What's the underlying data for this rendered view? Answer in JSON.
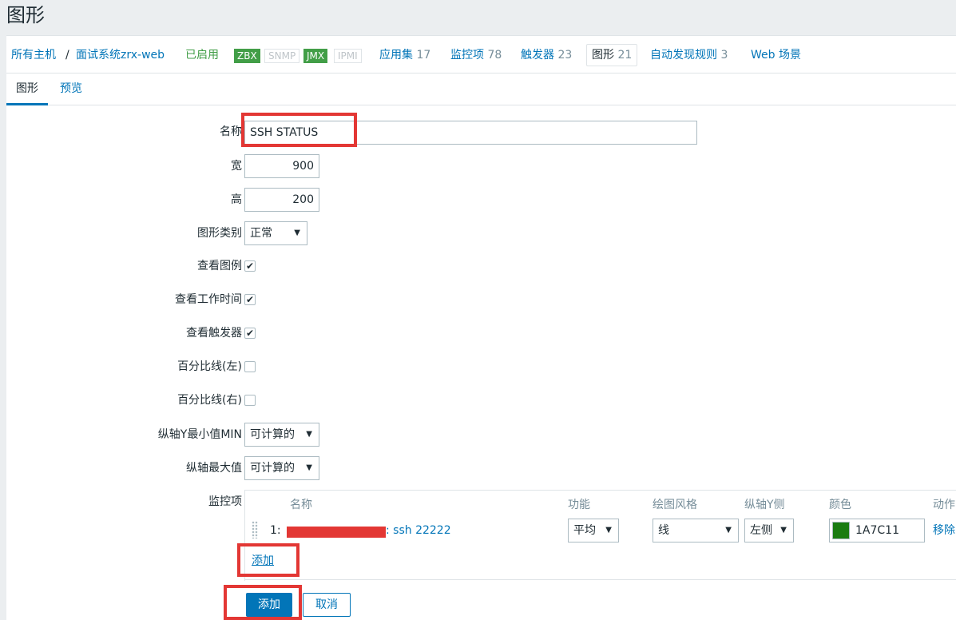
{
  "page": {
    "title": "图形"
  },
  "breadcrumb": {
    "all_hosts": "所有主机",
    "sep": "/",
    "host": "面试系统zrx-web"
  },
  "host_status": {
    "enabled": "已启用"
  },
  "badges": [
    {
      "label": "ZBX",
      "active": true
    },
    {
      "label": "SNMP",
      "active": false
    },
    {
      "label": "JMX",
      "active": true
    },
    {
      "label": "IPMI",
      "active": false
    }
  ],
  "host_nav": [
    {
      "label": "应用集",
      "count": "17"
    },
    {
      "label": "监控项",
      "count": "78"
    },
    {
      "label": "触发器",
      "count": "23"
    },
    {
      "label": "图形",
      "count": "21",
      "active": true
    },
    {
      "label": "自动发现规则",
      "count": "3"
    },
    {
      "label": "Web 场景",
      "count": ""
    }
  ],
  "tabs": [
    {
      "label": "图形",
      "active": true
    },
    {
      "label": "预览",
      "active": false
    }
  ],
  "form": {
    "name_label": "名称",
    "name_value": "SSH STATUS",
    "width_label": "宽",
    "width_value": "900",
    "height_label": "高",
    "height_value": "200",
    "graph_type_label": "图形类别",
    "graph_type_value": "正常",
    "show_legend_label": "查看图例",
    "show_legend": true,
    "show_working_time_label": "查看工作时间",
    "show_working_time": true,
    "show_triggers_label": "查看触发器",
    "show_triggers": true,
    "percentile_left_label": "百分比线(左)",
    "percentile_left": false,
    "percentile_right_label": "百分比线(右)",
    "percentile_right": false,
    "ymin_label": "纵轴Y最小值MIN",
    "ymin_value": "可计算的",
    "ymax_label": "纵轴最大值",
    "ymax_value": "可计算的",
    "items_label": "监控项"
  },
  "items_table": {
    "headers": {
      "name": "名称",
      "function": "功能",
      "draw_style": "绘图风格",
      "y_axis": "纵轴Y侧",
      "color": "颜色",
      "action": "动作"
    },
    "rows": [
      {
        "index": "1:",
        "name": ": ssh 22222",
        "function": "平均",
        "draw_style": "线",
        "y_axis": "左侧",
        "color_hex": "1A7C11",
        "action": "移除"
      }
    ],
    "add_link": "添加"
  },
  "buttons": {
    "add": "添加",
    "cancel": "取消"
  },
  "colors": {
    "item_color": "#1A7C11",
    "accent": "#0275b8",
    "highlight": "#e33734"
  }
}
